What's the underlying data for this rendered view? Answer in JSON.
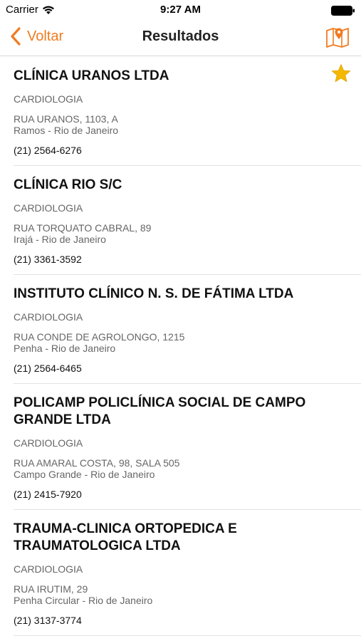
{
  "status_bar": {
    "carrier": "Carrier",
    "time": "9:27 AM"
  },
  "nav": {
    "back_label": "Voltar",
    "title": "Resultados",
    "accent_color": "#f07b20",
    "map_icon": "map-pin-icon"
  },
  "results": [
    {
      "name": "CLÍNICA URANOS LTDA",
      "specialty": "CARDIOLOGIA",
      "street": "RUA URANOS, 1103, A",
      "district": "Ramos - Rio de Janeiro",
      "phone": "(21) 2564-6276",
      "favorite": true
    },
    {
      "name": "CLÍNICA RIO S/C",
      "specialty": "CARDIOLOGIA",
      "street": "RUA TORQUATO CABRAL, 89",
      "district": "Irajá - Rio de Janeiro",
      "phone": "(21) 3361-3592",
      "favorite": false
    },
    {
      "name": "INSTITUTO CLÍNICO N. S. DE FÁTIMA LTDA",
      "specialty": "CARDIOLOGIA",
      "street": "RUA CONDE DE AGROLONGO, 1215",
      "district": "Penha - Rio de Janeiro",
      "phone": "(21) 2564-6465",
      "favorite": false
    },
    {
      "name": "POLICAMP POLICLÍNICA SOCIAL DE CAMPO GRANDE LTDA",
      "specialty": "CARDIOLOGIA",
      "street": "RUA AMARAL COSTA, 98, SALA 505",
      "district": "Campo Grande - Rio de Janeiro",
      "phone": "(21) 2415-7920",
      "favorite": false
    },
    {
      "name": "TRAUMA-CLINICA ORTOPEDICA E TRAUMATOLOGICA LTDA",
      "specialty": "CARDIOLOGIA",
      "street": "RUA IRUTIM, 29",
      "district": "Penha Circular - Rio de Janeiro",
      "phone": "(21) 3137-3774",
      "favorite": false
    }
  ]
}
